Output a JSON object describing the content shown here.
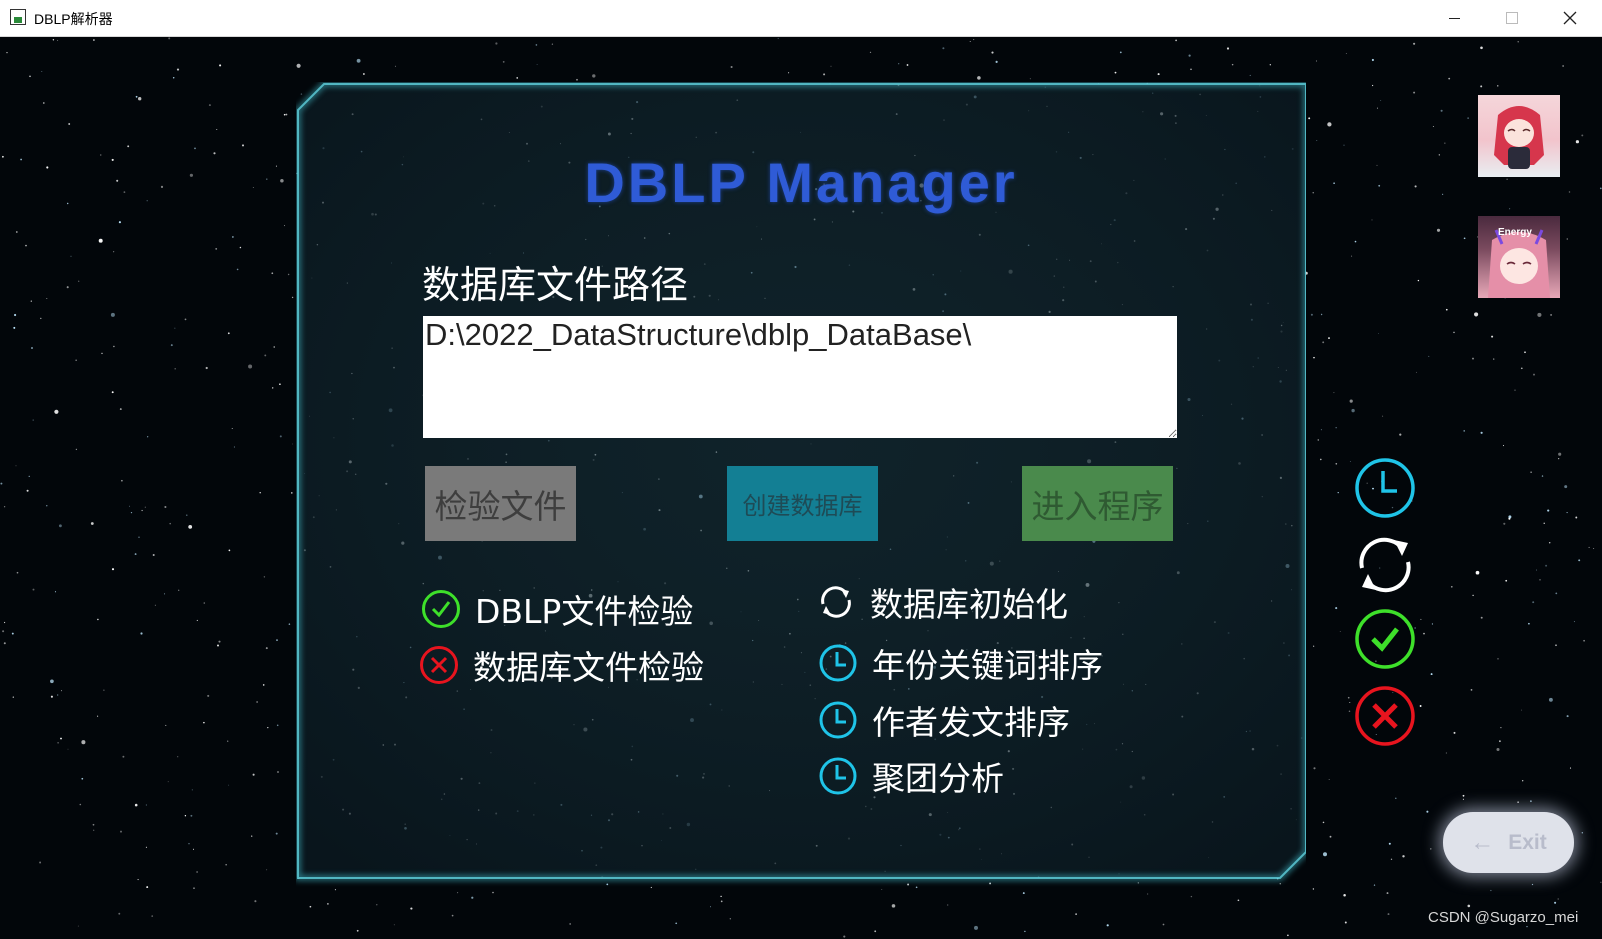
{
  "window": {
    "title": "DBLP解析器",
    "controls": [
      "minimize",
      "maximize",
      "close"
    ]
  },
  "main": {
    "title": "DBLP Manager",
    "path_label": "数据库文件路径",
    "path_value": "D:\\2022_DataStructure\\dblp_DataBase\\",
    "buttons": {
      "check": "检验文件",
      "create": "创建数据库",
      "enter": "进入程序"
    },
    "status_left": [
      {
        "label": "DBLP文件检验",
        "icon": "check-circle-icon",
        "state": "success"
      },
      {
        "label": "数据库文件检验",
        "icon": "x-circle-icon",
        "state": "failed"
      }
    ],
    "status_right": [
      {
        "label": "数据库初始化",
        "icon": "refresh-icon",
        "state": "running"
      },
      {
        "label": "年份关键词排序",
        "icon": "clock-icon",
        "state": "pending"
      },
      {
        "label": "作者发文排序",
        "icon": "clock-icon",
        "state": "pending"
      },
      {
        "label": "聚团分析",
        "icon": "clock-icon",
        "state": "pending"
      }
    ]
  },
  "sidebar": {
    "avatar_badge": "Energy",
    "legend": [
      "clock-icon",
      "refresh-icon",
      "check-circle-icon",
      "x-circle-icon"
    ]
  },
  "exit": {
    "label": "Exit",
    "icon": "arrow-left-icon"
  },
  "watermark": "CSDN @Sugarzo_mei",
  "colors": {
    "title": "#2f5bd6",
    "frame": "#3fb8c8",
    "pending": "#1fc4e8",
    "success": "#3ee02a",
    "failed": "#e8141e",
    "check_button": "#7a7a7a",
    "create_button": "#137f94",
    "enter_button": "#4a8a4c"
  }
}
